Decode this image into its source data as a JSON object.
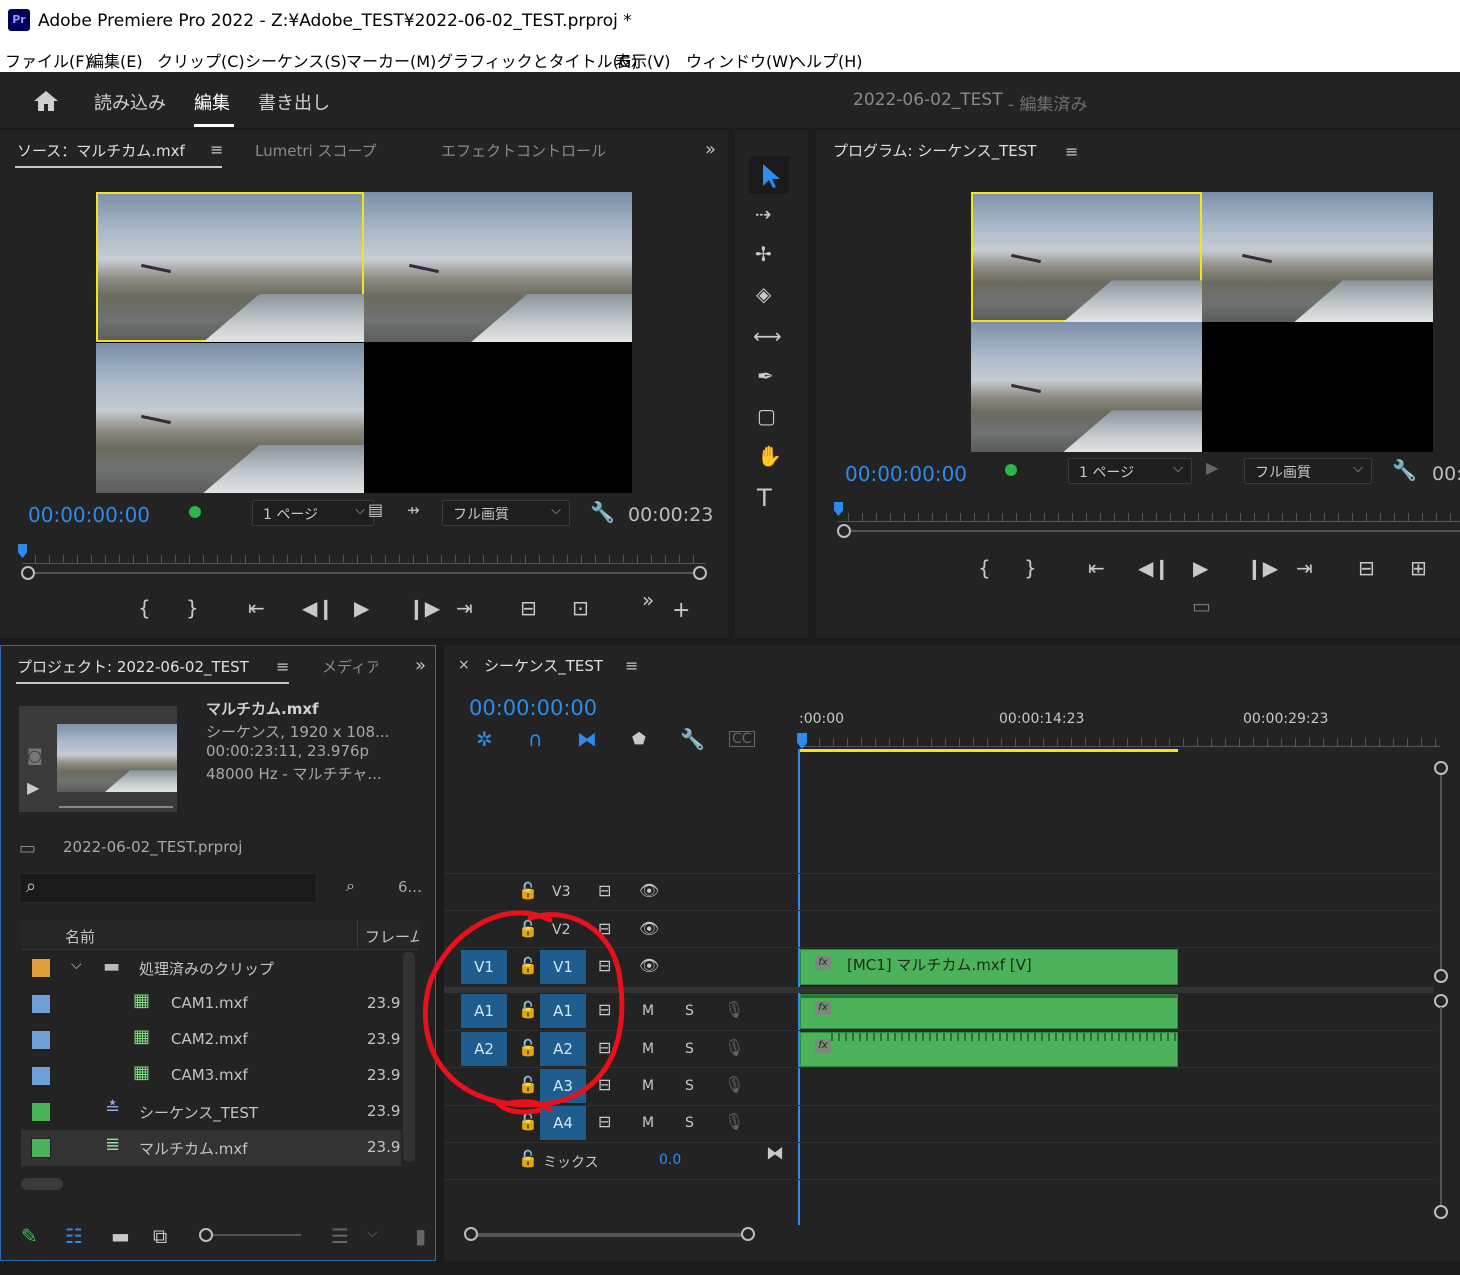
{
  "window": {
    "app_badge": "Pr",
    "title": "Adobe Premiere Pro 2022 - Z:¥Adobe_TEST¥2022-06-02_TEST.prproj *"
  },
  "menu": [
    "ファイル(F)",
    "編集(E)",
    "クリップ(C)",
    "シーケンス(S)",
    "マーカー(M)",
    "グラフィックとタイトル(G)",
    "表示(V)",
    "ウィンドウ(W)",
    "ヘルプ(H)"
  ],
  "workspace": {
    "tabs": [
      "読み込み",
      "編集",
      "書き出し"
    ],
    "active_tab": "編集",
    "project_title": "2022-06-02_TEST",
    "project_status": " - 編集済み"
  },
  "source_panel": {
    "tabs": [
      "ソース：マルチカム.mxf",
      "Lumetri スコープ",
      "エフェクトコントロール"
    ],
    "timecode_in": "00:00:00:00",
    "page_select": "1 ページ",
    "quality_select": "フル画質",
    "duration": "00:00:23"
  },
  "program_panel": {
    "title": "プログラム: シーケンス_TEST",
    "timecode": "00:00:00:00",
    "page_select": "1 ページ",
    "quality_select": "フル画質",
    "timecode_end": "00:"
  },
  "project_panel": {
    "tab": "プロジェクト: 2022-06-02_TEST",
    "tab2": "メディア",
    "clip_name": "マルチカム.mxf",
    "clip_info": [
      "シーケンス, 1920 x 108...",
      "00:00:23:11, 23.976p",
      "48000 Hz - マルチチャ..."
    ],
    "project_file": "2022-06-02_TEST.prproj",
    "item_count": "6...",
    "col_name": "名前",
    "col_frame": "フレーム",
    "rows": [
      {
        "name": "処理済みのクリップ",
        "frame": "",
        "color": "#e0a040",
        "type": "folder"
      },
      {
        "name": "CAM1.mxf",
        "frame": "23.9",
        "color": "#6fa0d8",
        "type": "clip"
      },
      {
        "name": "CAM2.mxf",
        "frame": "23.9",
        "color": "#6fa0d8",
        "type": "clip"
      },
      {
        "name": "CAM3.mxf",
        "frame": "23.9",
        "color": "#6fa0d8",
        "type": "clip"
      },
      {
        "name": "シーケンス_TEST",
        "frame": "23.9",
        "color": "#4bb35a",
        "type": "sequence"
      },
      {
        "name": "マルチカム.mxf",
        "frame": "23.9",
        "color": "#4bb35a",
        "type": "multicam"
      }
    ]
  },
  "timeline": {
    "tab": "シーケンス_TEST",
    "timecode": "00:00:00:00",
    "ruler_labels": [
      ":00:00",
      "00:00:14:23",
      "00:00:29:23"
    ],
    "video_tracks": [
      "V3",
      "V2",
      "V1"
    ],
    "audio_tracks": [
      "A1",
      "A2",
      "A3",
      "A4"
    ],
    "source_v": "V1",
    "source_a": [
      "A1",
      "A2"
    ],
    "mute_label": "M",
    "solo_label": "S",
    "mix_label": "ミックス",
    "mix_value": "0.0",
    "video_clip_label": "[MC1] マルチカム.mxf [V]",
    "fx_label": "fx"
  },
  "colors": {
    "accent_blue": "#2d8ceb",
    "clip_green": "#4db35a",
    "selection_yellow": "#f5e21b",
    "annotation_red": "#e8101a",
    "track_target": "#1f5d8f"
  }
}
